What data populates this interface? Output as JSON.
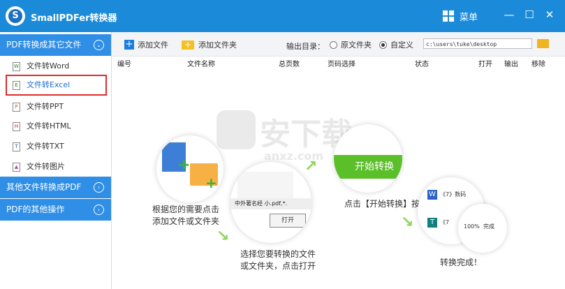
{
  "app": {
    "title": "SmallPDFer转换器",
    "logo_letter": "S"
  },
  "titlebar": {
    "menu_label": "菜单",
    "minimize": "—",
    "maximize": "☐",
    "close": "✕"
  },
  "sidebar": {
    "categories": [
      {
        "label": "PDF转换成其它文件",
        "chevron": "⌄"
      },
      {
        "label": "其他文件转换成PDF",
        "chevron": "›"
      },
      {
        "label": "PDF的其他操作",
        "chevron": "›"
      }
    ],
    "items": [
      {
        "label": "文件转Word",
        "icon": "word-file-icon"
      },
      {
        "label": "文件转Excel",
        "icon": "excel-file-icon"
      },
      {
        "label": "文件转PPT",
        "icon": "ppt-file-icon"
      },
      {
        "label": "文件转HTML",
        "icon": "html-file-icon"
      },
      {
        "label": "文件转TXT",
        "icon": "txt-file-icon"
      },
      {
        "label": "文件转图片",
        "icon": "image-file-icon"
      }
    ],
    "selected_index": 1
  },
  "toolbar": {
    "add_file": "添加文件",
    "add_folder": "添加文件夹",
    "output_label": "输出目录：",
    "radio_original": "原文件夹",
    "radio_custom": "自定义",
    "selected_radio": "custom",
    "path": "c:\\users\\tuke\\desktop"
  },
  "table": {
    "columns": [
      "编号",
      "文件名称",
      "总页数",
      "页码选择",
      "状态",
      "打开",
      "输出",
      "移除"
    ]
  },
  "guide": {
    "step1": "根据您的需要点击\n添加文件或文件夹",
    "step2": "选择您要转换的文件\n或文件夹，点击打开",
    "step3": "点击【开始转换】按钮",
    "step4": "转换完成！",
    "start_button": "开始转换",
    "dialog_file": "中外著名经 小.pdf,*.",
    "dialog_open": "打开",
    "result_word": "《7》数码",
    "result_other": "《7",
    "progress_text": "100%  完成"
  },
  "watermark": {
    "text": "安下载",
    "url": "anxz.com"
  },
  "colors": {
    "titlebar": "#1b8bd9",
    "category": "#2f8ee5",
    "selected_border": "#e02b2b",
    "start_green": "#5bbf2a"
  }
}
